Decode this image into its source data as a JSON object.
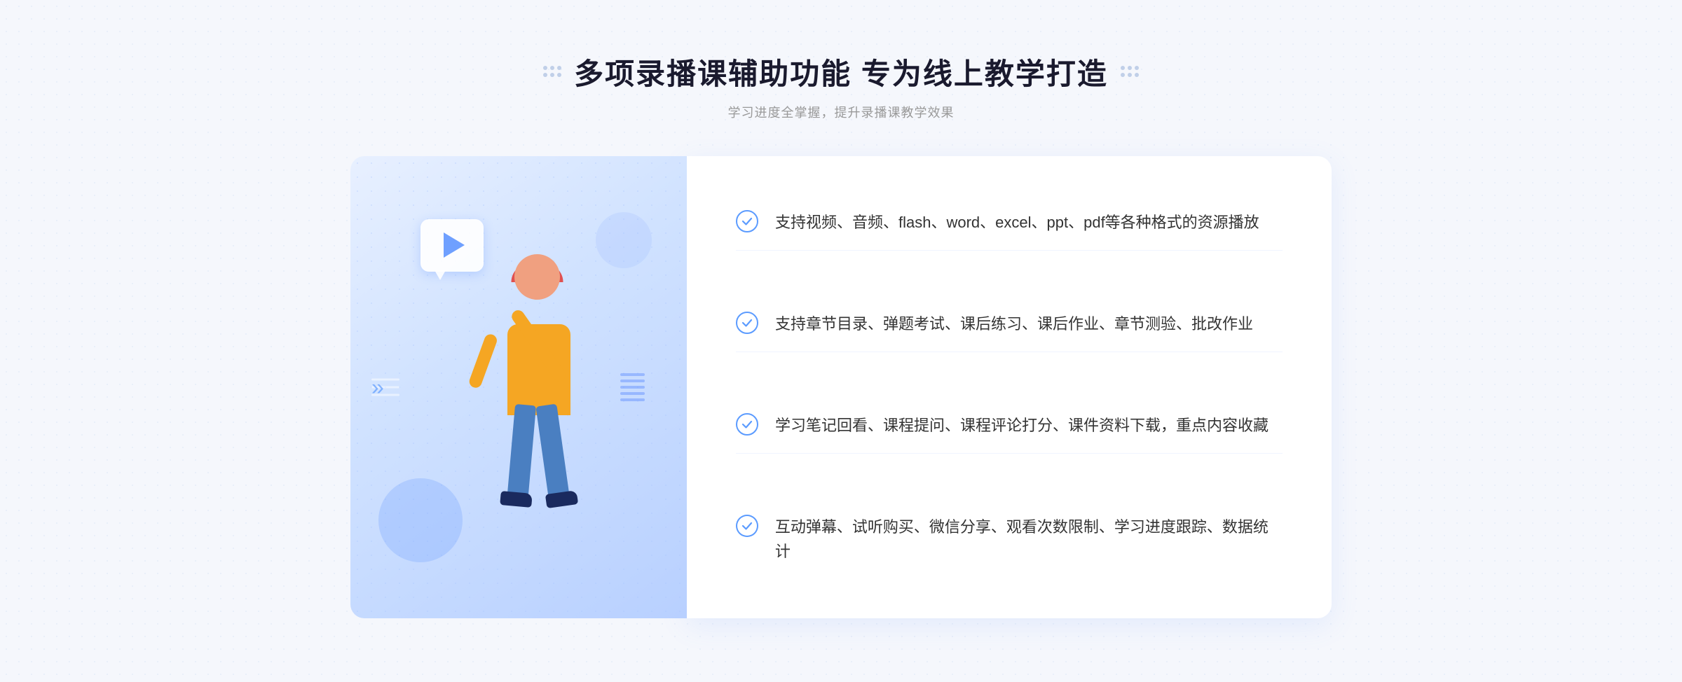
{
  "header": {
    "title": "多项录播课辅助功能 专为线上教学打造",
    "subtitle": "学习进度全掌握，提升录播课教学效果"
  },
  "features": [
    {
      "id": 1,
      "text": "支持视频、音频、flash、word、excel、ppt、pdf等各种格式的资源播放"
    },
    {
      "id": 2,
      "text": "支持章节目录、弹题考试、课后练习、课后作业、章节测验、批改作业"
    },
    {
      "id": 3,
      "text": "学习笔记回看、课程提问、课程评论打分、课件资料下载，重点内容收藏"
    },
    {
      "id": 4,
      "text": "互动弹幕、试听购买、微信分享、观看次数限制、学习进度跟踪、数据统计"
    }
  ],
  "decorations": {
    "leftArrow": "»"
  }
}
